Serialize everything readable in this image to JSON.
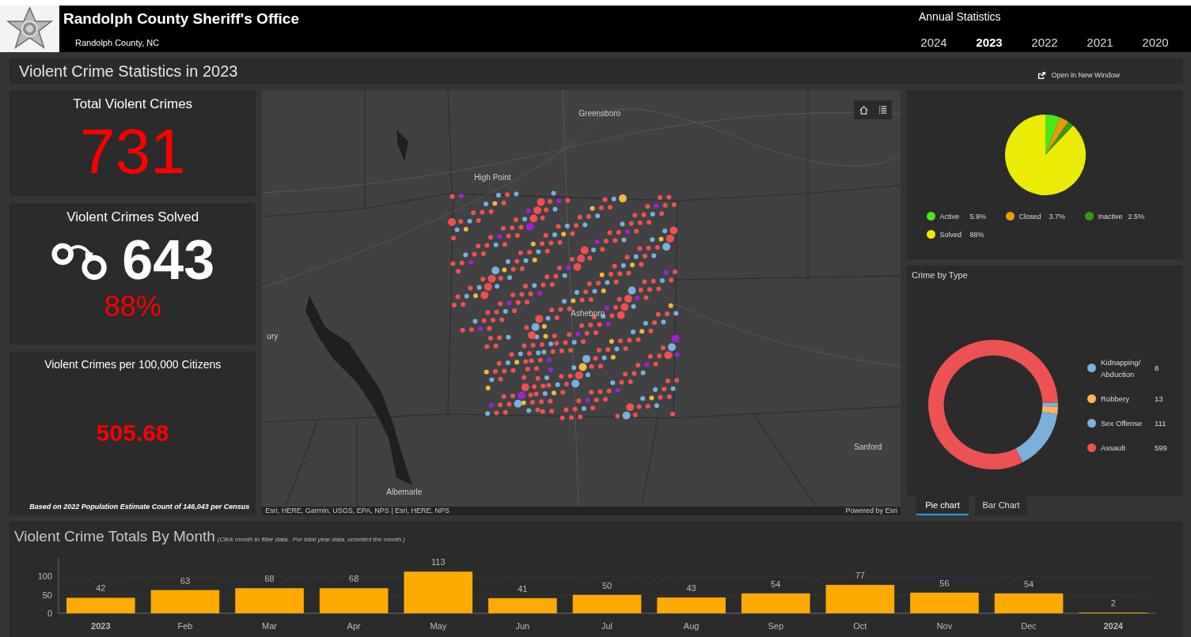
{
  "header": {
    "title": "Randolph County Sheriff's Office",
    "subtitle": "Randolph County, NC",
    "annual_label": "Annual Statistics",
    "year_tabs": [
      {
        "label": "2024",
        "selected": false
      },
      {
        "label": "2023",
        "selected": true
      },
      {
        "label": "2022",
        "selected": false
      },
      {
        "label": "2021",
        "selected": false
      },
      {
        "label": "2020",
        "selected": false
      }
    ]
  },
  "page_title": "Violent Crime Statistics in 2023",
  "open_window_link": "Open in New Window",
  "total": {
    "title": "Total Violent Crimes",
    "value": "731"
  },
  "solved": {
    "title": "Violent Crimes Solved",
    "value": "643",
    "percent": "88%"
  },
  "per_capita": {
    "title": "Violent Crimes per 100,000 Citizens",
    "value": "505.68",
    "note": "Based on 2022 Population Estimate Count of 146,043 per Census"
  },
  "map": {
    "labels": [
      "Greensboro",
      "High Point",
      "Asheboro",
      "ury",
      "Sanford",
      "Albemarle"
    ],
    "attribution": "Esri, HERE, Garmin, USGS, EPA, NPS | Esri, HERE, NPS",
    "powered_by": "Powered by Esri"
  },
  "status_chart": {
    "chart_data": {
      "type": "pie",
      "categories": [
        "Active",
        "Closed",
        "Inactive",
        "Solved"
      ],
      "values": [
        5.9,
        3.7,
        2.5,
        88
      ]
    },
    "legend": [
      {
        "value": "5.9%",
        "color": "#4de619"
      },
      {
        "value": "3.7%",
        "color": "#e89b0c"
      },
      {
        "value": "2.5%",
        "color": "#3a9a0e"
      },
      {
        "value": "88%",
        "color": "#ebeb05"
      }
    ]
  },
  "type_chart": {
    "title": "Crime by Type",
    "chart_data": {
      "type": "donut",
      "categories": [
        "Kidnapping/ Abduction",
        "Robbery",
        "Sex Offense",
        "Assault"
      ],
      "values": [
        1.09,
        1.78,
        15.18,
        81.95
      ]
    },
    "legend": [
      {
        "value": "8",
        "color": "#7ab0dc"
      },
      {
        "value": "13",
        "color": "#fbb65b"
      },
      {
        "value": "111",
        "color": "#7ab0dc"
      },
      {
        "value": "599",
        "color": "#ed5151"
      }
    ]
  },
  "chart_toggle": [
    {
      "label": "Pie chart",
      "selected": true
    },
    {
      "label": "Bar Chart",
      "selected": false
    }
  ],
  "monthly": {
    "title": "Violent Crime Totals By Month",
    "hint": "(Click month to filter data.  For total year data, unselect the month.)",
    "chart_data": {
      "type": "bar",
      "categories": [
        "2023",
        "Feb",
        "Mar",
        "Apr",
        "May",
        "Jun",
        "Jul",
        "Aug",
        "Sep",
        "Oct",
        "Nov",
        "Dec",
        "2024"
      ],
      "series": [
        {
          "color": "#ffaa00",
          "values": [
            42,
            63,
            68,
            68,
            113,
            41,
            50,
            43,
            54,
            77,
            56,
            54,
            2
          ]
        }
      ],
      "ylim": [
        0,
        150
      ],
      "yticks": [
        0,
        50,
        100
      ],
      "data_labels": true
    }
  }
}
